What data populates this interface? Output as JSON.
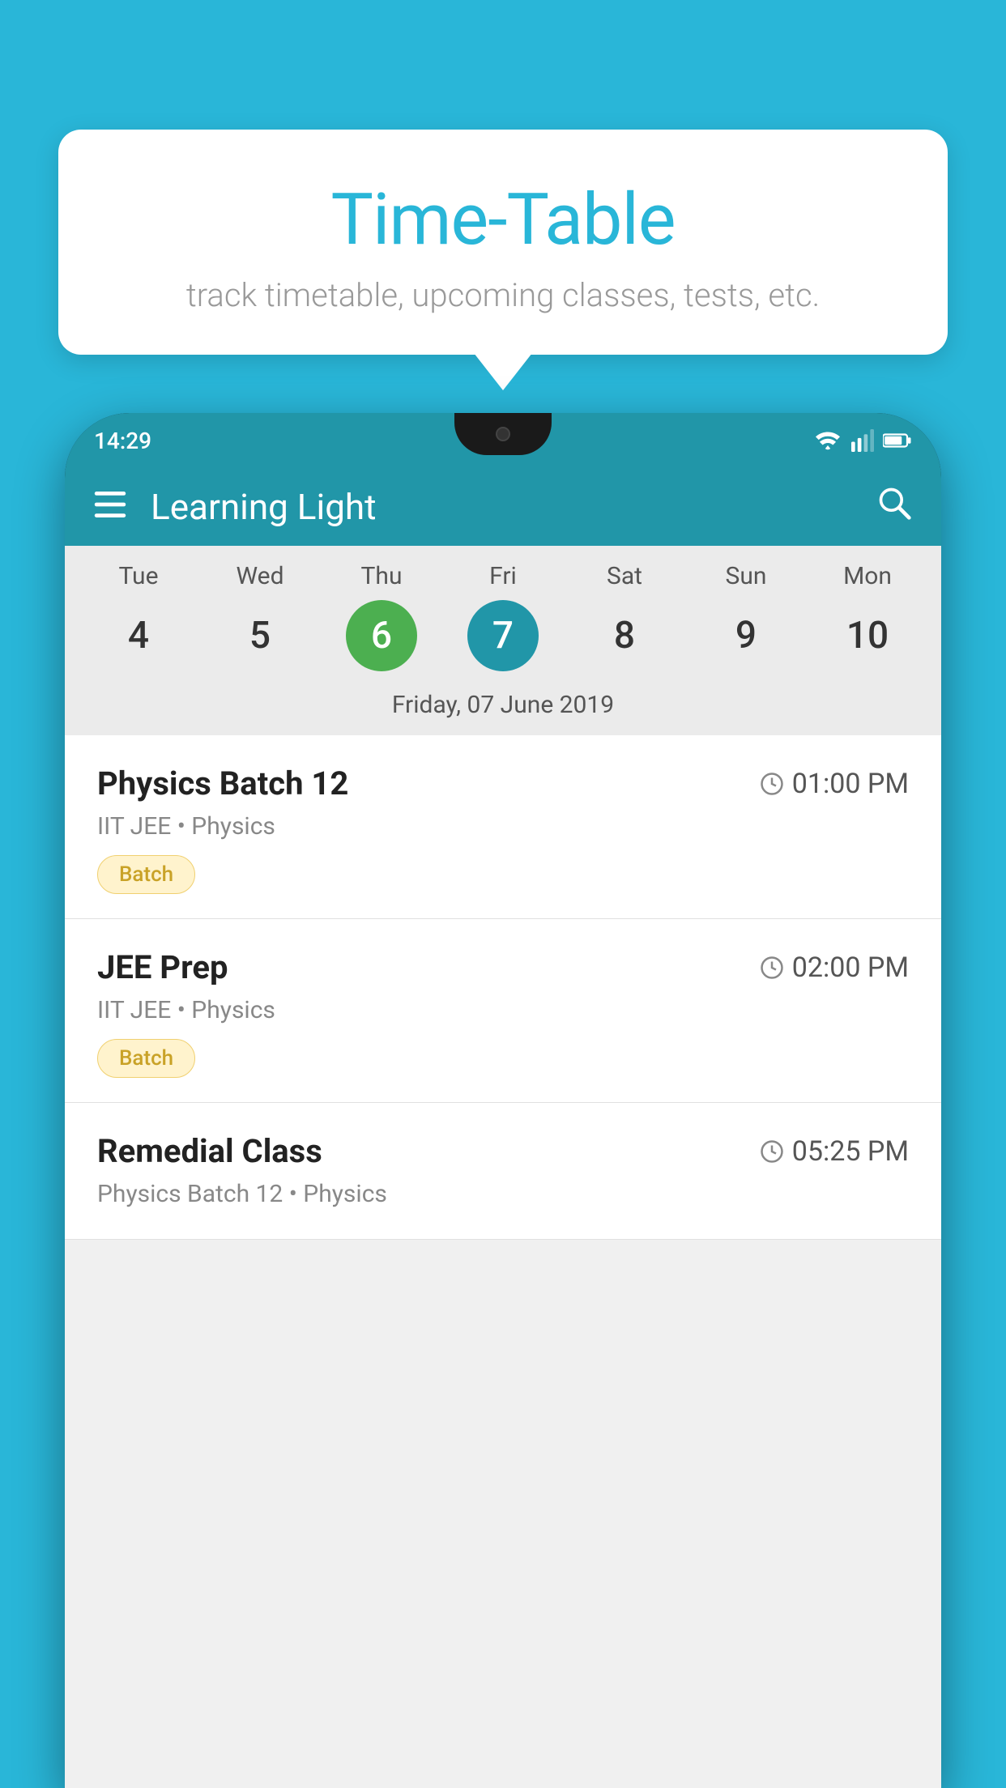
{
  "background_color": "#29b6d8",
  "tooltip": {
    "title": "Time-Table",
    "subtitle": "track timetable, upcoming classes, tests, etc."
  },
  "phone": {
    "status_bar": {
      "time": "14:29"
    },
    "app_bar": {
      "title": "Learning Light"
    },
    "calendar": {
      "days": [
        {
          "name": "Tue",
          "num": "4",
          "state": "normal"
        },
        {
          "name": "Wed",
          "num": "5",
          "state": "normal"
        },
        {
          "name": "Thu",
          "num": "6",
          "state": "today"
        },
        {
          "name": "Fri",
          "num": "7",
          "state": "selected"
        },
        {
          "name": "Sat",
          "num": "8",
          "state": "normal"
        },
        {
          "name": "Sun",
          "num": "9",
          "state": "normal"
        },
        {
          "name": "Mon",
          "num": "10",
          "state": "normal"
        }
      ],
      "selected_date_label": "Friday, 07 June 2019"
    },
    "schedule": [
      {
        "name": "Physics Batch 12",
        "time": "01:00 PM",
        "meta": "IIT JEE • Physics",
        "badge": "Batch"
      },
      {
        "name": "JEE Prep",
        "time": "02:00 PM",
        "meta": "IIT JEE • Physics",
        "badge": "Batch"
      },
      {
        "name": "Remedial Class",
        "time": "05:25 PM",
        "meta": "Physics Batch 12 • Physics",
        "badge": null,
        "partial": true
      }
    ]
  }
}
